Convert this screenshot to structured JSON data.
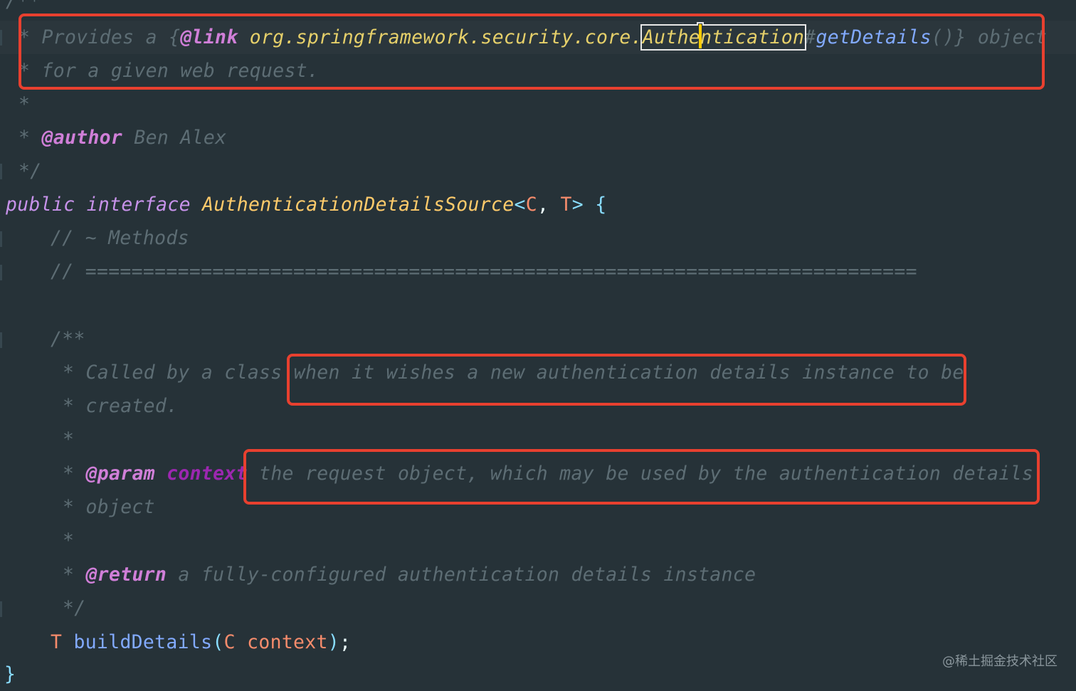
{
  "code": {
    "l0": "/**",
    "l1": {
      "star": "* Provides a {",
      "tag": "@link",
      "pkg": " org.springframework.security.core.",
      "sel_a": "Authe",
      "sel_b": "ntication",
      "hash": "#",
      "method": "getDetails",
      "rest": "()} object"
    },
    "l2": "* for a given web request.",
    "l3": "*",
    "l4": {
      "star": "* ",
      "tag": "@author",
      "rest": " Ben Alex"
    },
    "l5": "*/",
    "l6": {
      "kw1": "public",
      "kw2": " interface ",
      "cls": "AuthenticationDetailsSource",
      "lt": "<",
      "c": "C",
      "comma": ", ",
      "t": "T",
      "gt": ">",
      "brace": " {"
    },
    "l7": "// ~ Methods",
    "l8": "// ========================================================================",
    "l9": "/**",
    "l10": "* Called by a class when it wishes a new authentication details instance to be",
    "l11": "* created.",
    "l12": "*",
    "l13": {
      "star": "* ",
      "tag": "@param",
      "name": " context",
      "rest": " the request object, which may be used by the authentication details"
    },
    "l14": "* object",
    "l15": "*",
    "l16": {
      "star": "* ",
      "tag": "@return",
      "rest": " a fully-configured authentication details instance"
    },
    "l17": "*/",
    "l18": {
      "t": "T",
      "fn": " buildDetails",
      "open": "(",
      "c": "C",
      "arg": " context",
      "close": ")",
      "semi": ";"
    },
    "l19": "}"
  },
  "watermark": "@稀土掘金技术社区",
  "colors": {
    "background": "#263238",
    "highlight_box": "#e8402f",
    "caret": "#ffcc00"
  }
}
